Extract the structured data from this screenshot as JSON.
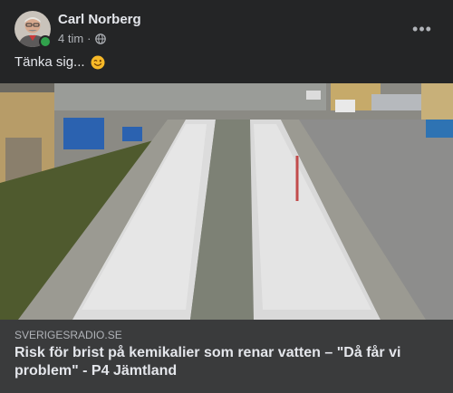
{
  "post": {
    "author": "Carl Norberg",
    "time": "4 tim",
    "separator": "·",
    "text": "Tänka sig...",
    "emoji_icon": "smiling-face-with-wink-emoji",
    "privacy_icon": "globe-icon",
    "more_icon": "more-options-icon",
    "more_label": "•••"
  },
  "link": {
    "domain": "SVERIGESRADIO.SE",
    "headline": "Risk för brist på kemikalier som renar vatten – \"Då får vi problem\" - P4 Jämtland"
  },
  "colors": {
    "background": "#242526",
    "link_footer": "#3a3b3c",
    "online": "#31a24c",
    "text_primary": "#e4e6eb",
    "text_secondary": "#b0b3b8"
  }
}
